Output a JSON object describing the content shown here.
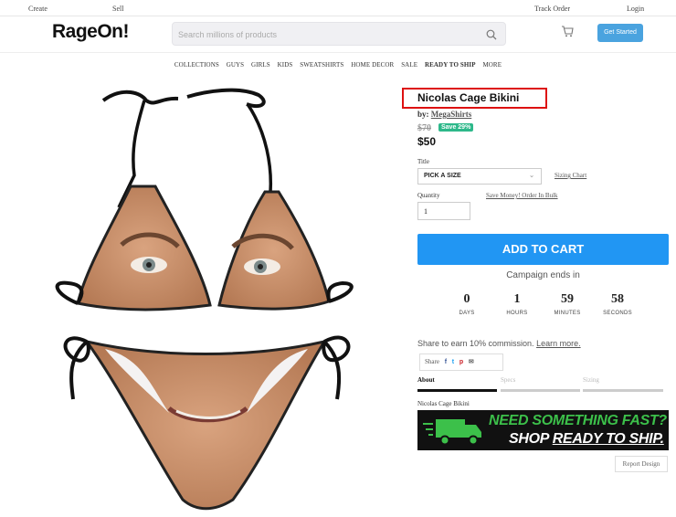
{
  "topbar": {
    "create": "Create",
    "sell": "Sell",
    "track_order": "Track Order",
    "login": "Login"
  },
  "header": {
    "logo": "RageOn!",
    "search_placeholder": "Search millions of products",
    "get_started": "Get Started"
  },
  "nav": {
    "items": [
      "COLLECTIONS",
      "GUYS",
      "GIRLS",
      "KIDS",
      "SWEATSHIRTS",
      "HOME DECOR",
      "SALE",
      "READY TO SHIP",
      "MORE"
    ]
  },
  "product": {
    "title": "Nicolas Cage Bikini",
    "by_label": "by:",
    "seller": "MegaShirts",
    "old_price": "$70",
    "save_badge": "Save 29%",
    "price": "$50",
    "title_label": "Title",
    "size_select": "PICK A SIZE",
    "sizing_chart": "Sizing Chart",
    "quantity_label": "Quantity",
    "bulk_link": "Save Money! Order In Bulk",
    "quantity_value": "1",
    "add_to_cart": "ADD TO CART",
    "campaign_text": "Campaign ends in",
    "countdown": [
      {
        "value": "0",
        "unit": "DAYS"
      },
      {
        "value": "1",
        "unit": "HOURS"
      },
      {
        "value": "59",
        "unit": "MINUTES"
      },
      {
        "value": "58",
        "unit": "SECONDS"
      }
    ],
    "share_earn": "Share to earn 10% commission.",
    "learn_more": "Learn more.",
    "share_label": "Share",
    "tabs": [
      "About",
      "Specs",
      "Sizing"
    ],
    "description": "Nicolas Cage Bikini",
    "report_design": "Report Design"
  },
  "banner": {
    "line1": "NEED SOMETHING FAST?",
    "line2a": "SHOP ",
    "line2b": "READY TO SHIP."
  },
  "colors": {
    "primary": "#2196f3",
    "save_badge": "#2db88a",
    "highlight_box": "#dd1111",
    "banner_green": "#3cc04a"
  }
}
